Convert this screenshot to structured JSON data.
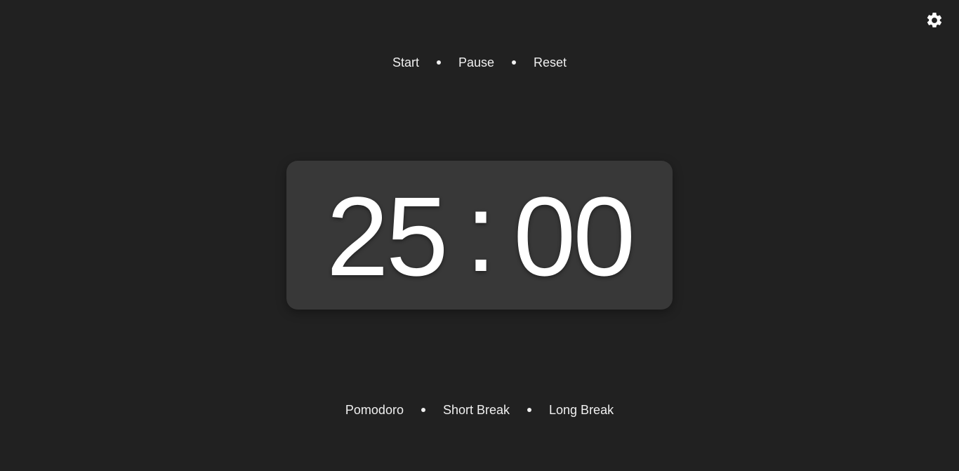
{
  "settings": {
    "icon": "gear-icon"
  },
  "controls": {
    "start_label": "Start",
    "pause_label": "Pause",
    "reset_label": "Reset"
  },
  "timer": {
    "minutes": "25",
    "separator": ":",
    "seconds": "00"
  },
  "modes": {
    "pomodoro_label": "Pomodoro",
    "short_break_label": "Short Break",
    "long_break_label": "Long Break"
  },
  "colors": {
    "background": "#212121",
    "timer_card": "#383838",
    "text": "#ffffff"
  }
}
